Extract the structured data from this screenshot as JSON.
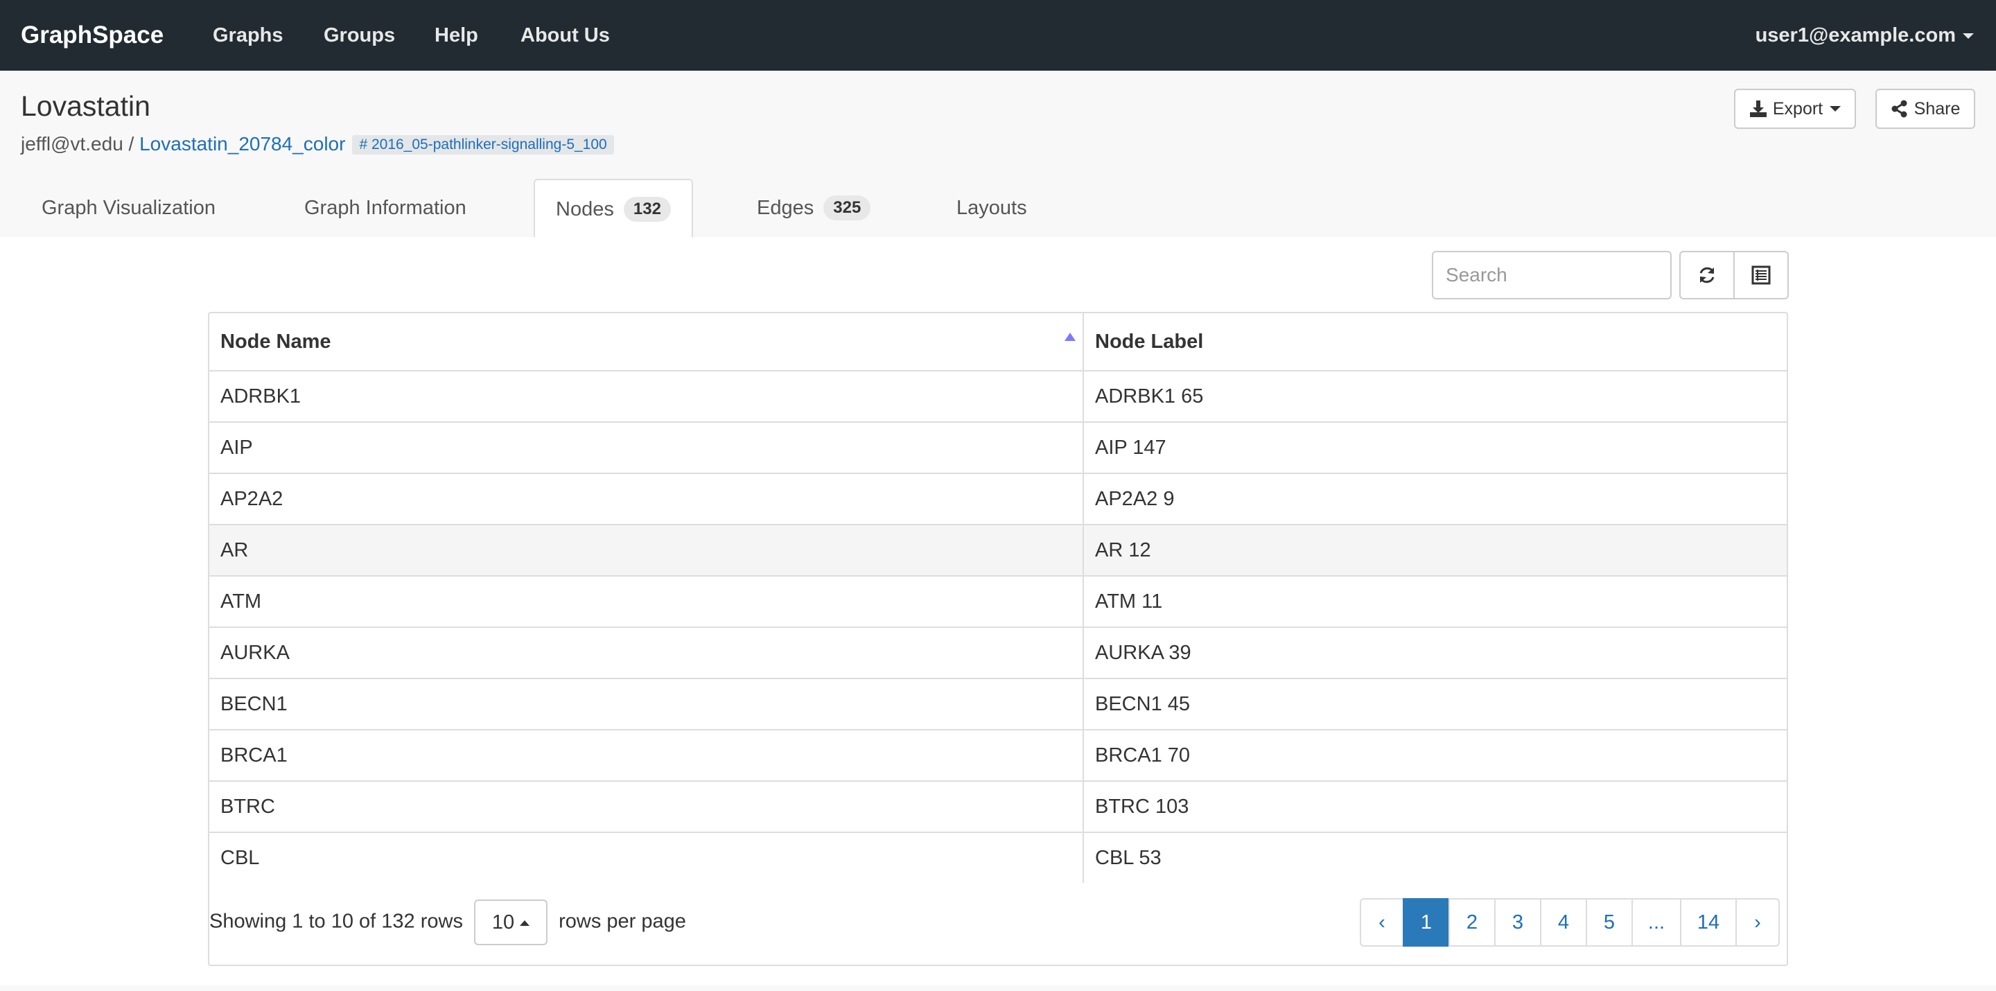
{
  "navbar": {
    "brand": "GraphSpace",
    "links": [
      "Graphs",
      "Groups",
      "Help",
      "About Us"
    ],
    "user": "user1@example.com"
  },
  "header": {
    "title": "Lovastatin",
    "owner": "jeffl@vt.edu",
    "separator": " / ",
    "graph_name": "Lovastatin_20784_color",
    "tag": "# 2016_05-pathlinker-signalling-5_100",
    "export_label": "Export",
    "share_label": "Share"
  },
  "tabs": {
    "visualization": "Graph Visualization",
    "information": "Graph Information",
    "nodes": "Nodes",
    "nodes_count": "132",
    "edges": "Edges",
    "edges_count": "325",
    "layouts": "Layouts"
  },
  "toolbar": {
    "search_placeholder": "Search"
  },
  "table": {
    "columns": [
      "Node Name",
      "Node Label"
    ],
    "rows": [
      [
        "ADRBK1",
        "ADRBK1 65"
      ],
      [
        "AIP",
        "AIP 147"
      ],
      [
        "AP2A2",
        "AP2A2 9"
      ],
      [
        "AR",
        "AR 12"
      ],
      [
        "ATM",
        "ATM 11"
      ],
      [
        "AURKA",
        "AURKA 39"
      ],
      [
        "BECN1",
        "BECN1 45"
      ],
      [
        "BRCA1",
        "BRCA1 70"
      ],
      [
        "BTRC",
        "BTRC 103"
      ],
      [
        "CBL",
        "CBL 53"
      ]
    ]
  },
  "pagination": {
    "showing": "Showing 1 to 10 of 132 rows",
    "per_page": "10",
    "per_page_suffix": "rows per page",
    "prev": "‹",
    "pages": [
      "1",
      "2",
      "3",
      "4",
      "5",
      "...",
      "14"
    ],
    "next": "›",
    "active_page": "1"
  },
  "colors": {
    "navbar_bg": "#222b32",
    "link": "#1d6fb8",
    "active_page": "#2a7ab9",
    "sort_arrow": "#7a7aff"
  },
  "icons": [
    "download-icon",
    "share-icon",
    "refresh-icon",
    "columns-icon"
  ]
}
